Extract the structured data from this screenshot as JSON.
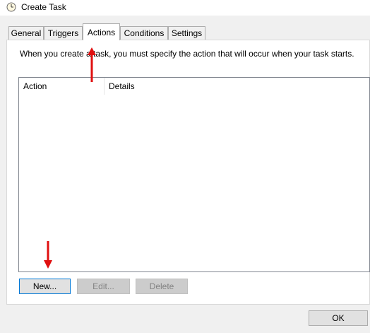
{
  "window": {
    "title": "Create Task"
  },
  "tabs": [
    {
      "label": "General"
    },
    {
      "label": "Triggers"
    },
    {
      "label": "Actions"
    },
    {
      "label": "Conditions"
    },
    {
      "label": "Settings"
    }
  ],
  "active_tab": "Actions",
  "actions_panel": {
    "description": "When you create a task, you must specify the action that will occur when your task starts.",
    "columns": [
      "Action",
      "Details"
    ],
    "rows": []
  },
  "buttons": {
    "new": "New...",
    "edit": "Edit...",
    "delete": "Delete",
    "ok": "OK"
  },
  "colors": {
    "annotation_arrow": "#e01010",
    "focus_border": "#0078d7"
  },
  "icons": {
    "title": "clock-icon"
  }
}
